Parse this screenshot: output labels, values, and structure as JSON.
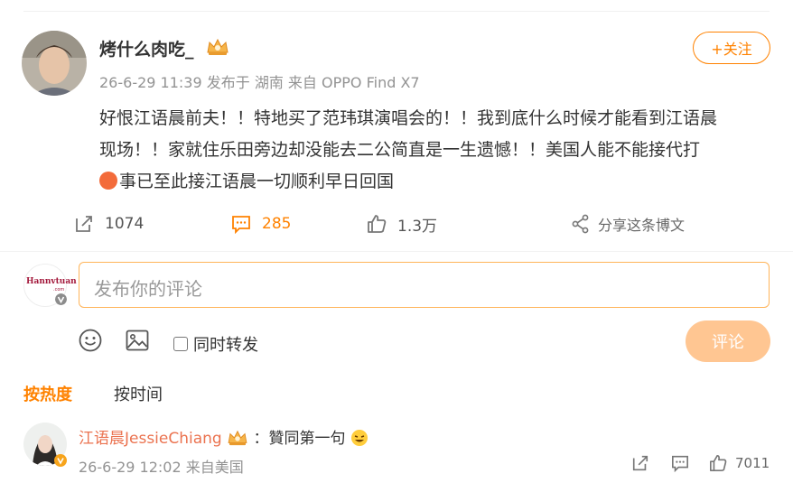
{
  "post": {
    "username": "烤什么肉吃_",
    "time": "26-6-29 11:39",
    "location": "发布于 湖南",
    "source": "来自 OPPO Find X7",
    "follow_label": "+关注",
    "text_lines": [
      "好恨江语晨前夫！！特地买了范玮琪演唱会的！！我到底什么时候才能看到江语晨",
      "现场！！家就住乐田旁边却没能去二公简直是一生遗憾！！美国人能不能接代打",
      "事已至此接江语晨一切顺利早日回国"
    ],
    "reposts": "1074",
    "comments": "285",
    "likes": "1.3万",
    "share_label": "分享这条博文"
  },
  "composer": {
    "avatar_logo": "Hannvtuan",
    "avatar_logo_sub": ".com",
    "placeholder": "发布你的评论",
    "repost_checkbox_label": "同时转发",
    "submit_label": "评论"
  },
  "sort_tabs": {
    "hot": "按热度",
    "time": "按时间"
  },
  "comment": {
    "name": "江语晨JessieChiang",
    "text": "：贊同第一句",
    "time": "26-6-29 12:02",
    "source": "来自美国",
    "likes": "7011"
  },
  "colors": {
    "accent": "#ff8200",
    "comment_name": "#eb7350",
    "submit_bg": "#ffc692"
  },
  "icons": [
    "crown-badge-icon",
    "repost-icon",
    "comment-icon",
    "like-icon",
    "share-icon",
    "emoji-icon",
    "image-icon",
    "verified-icon"
  ]
}
